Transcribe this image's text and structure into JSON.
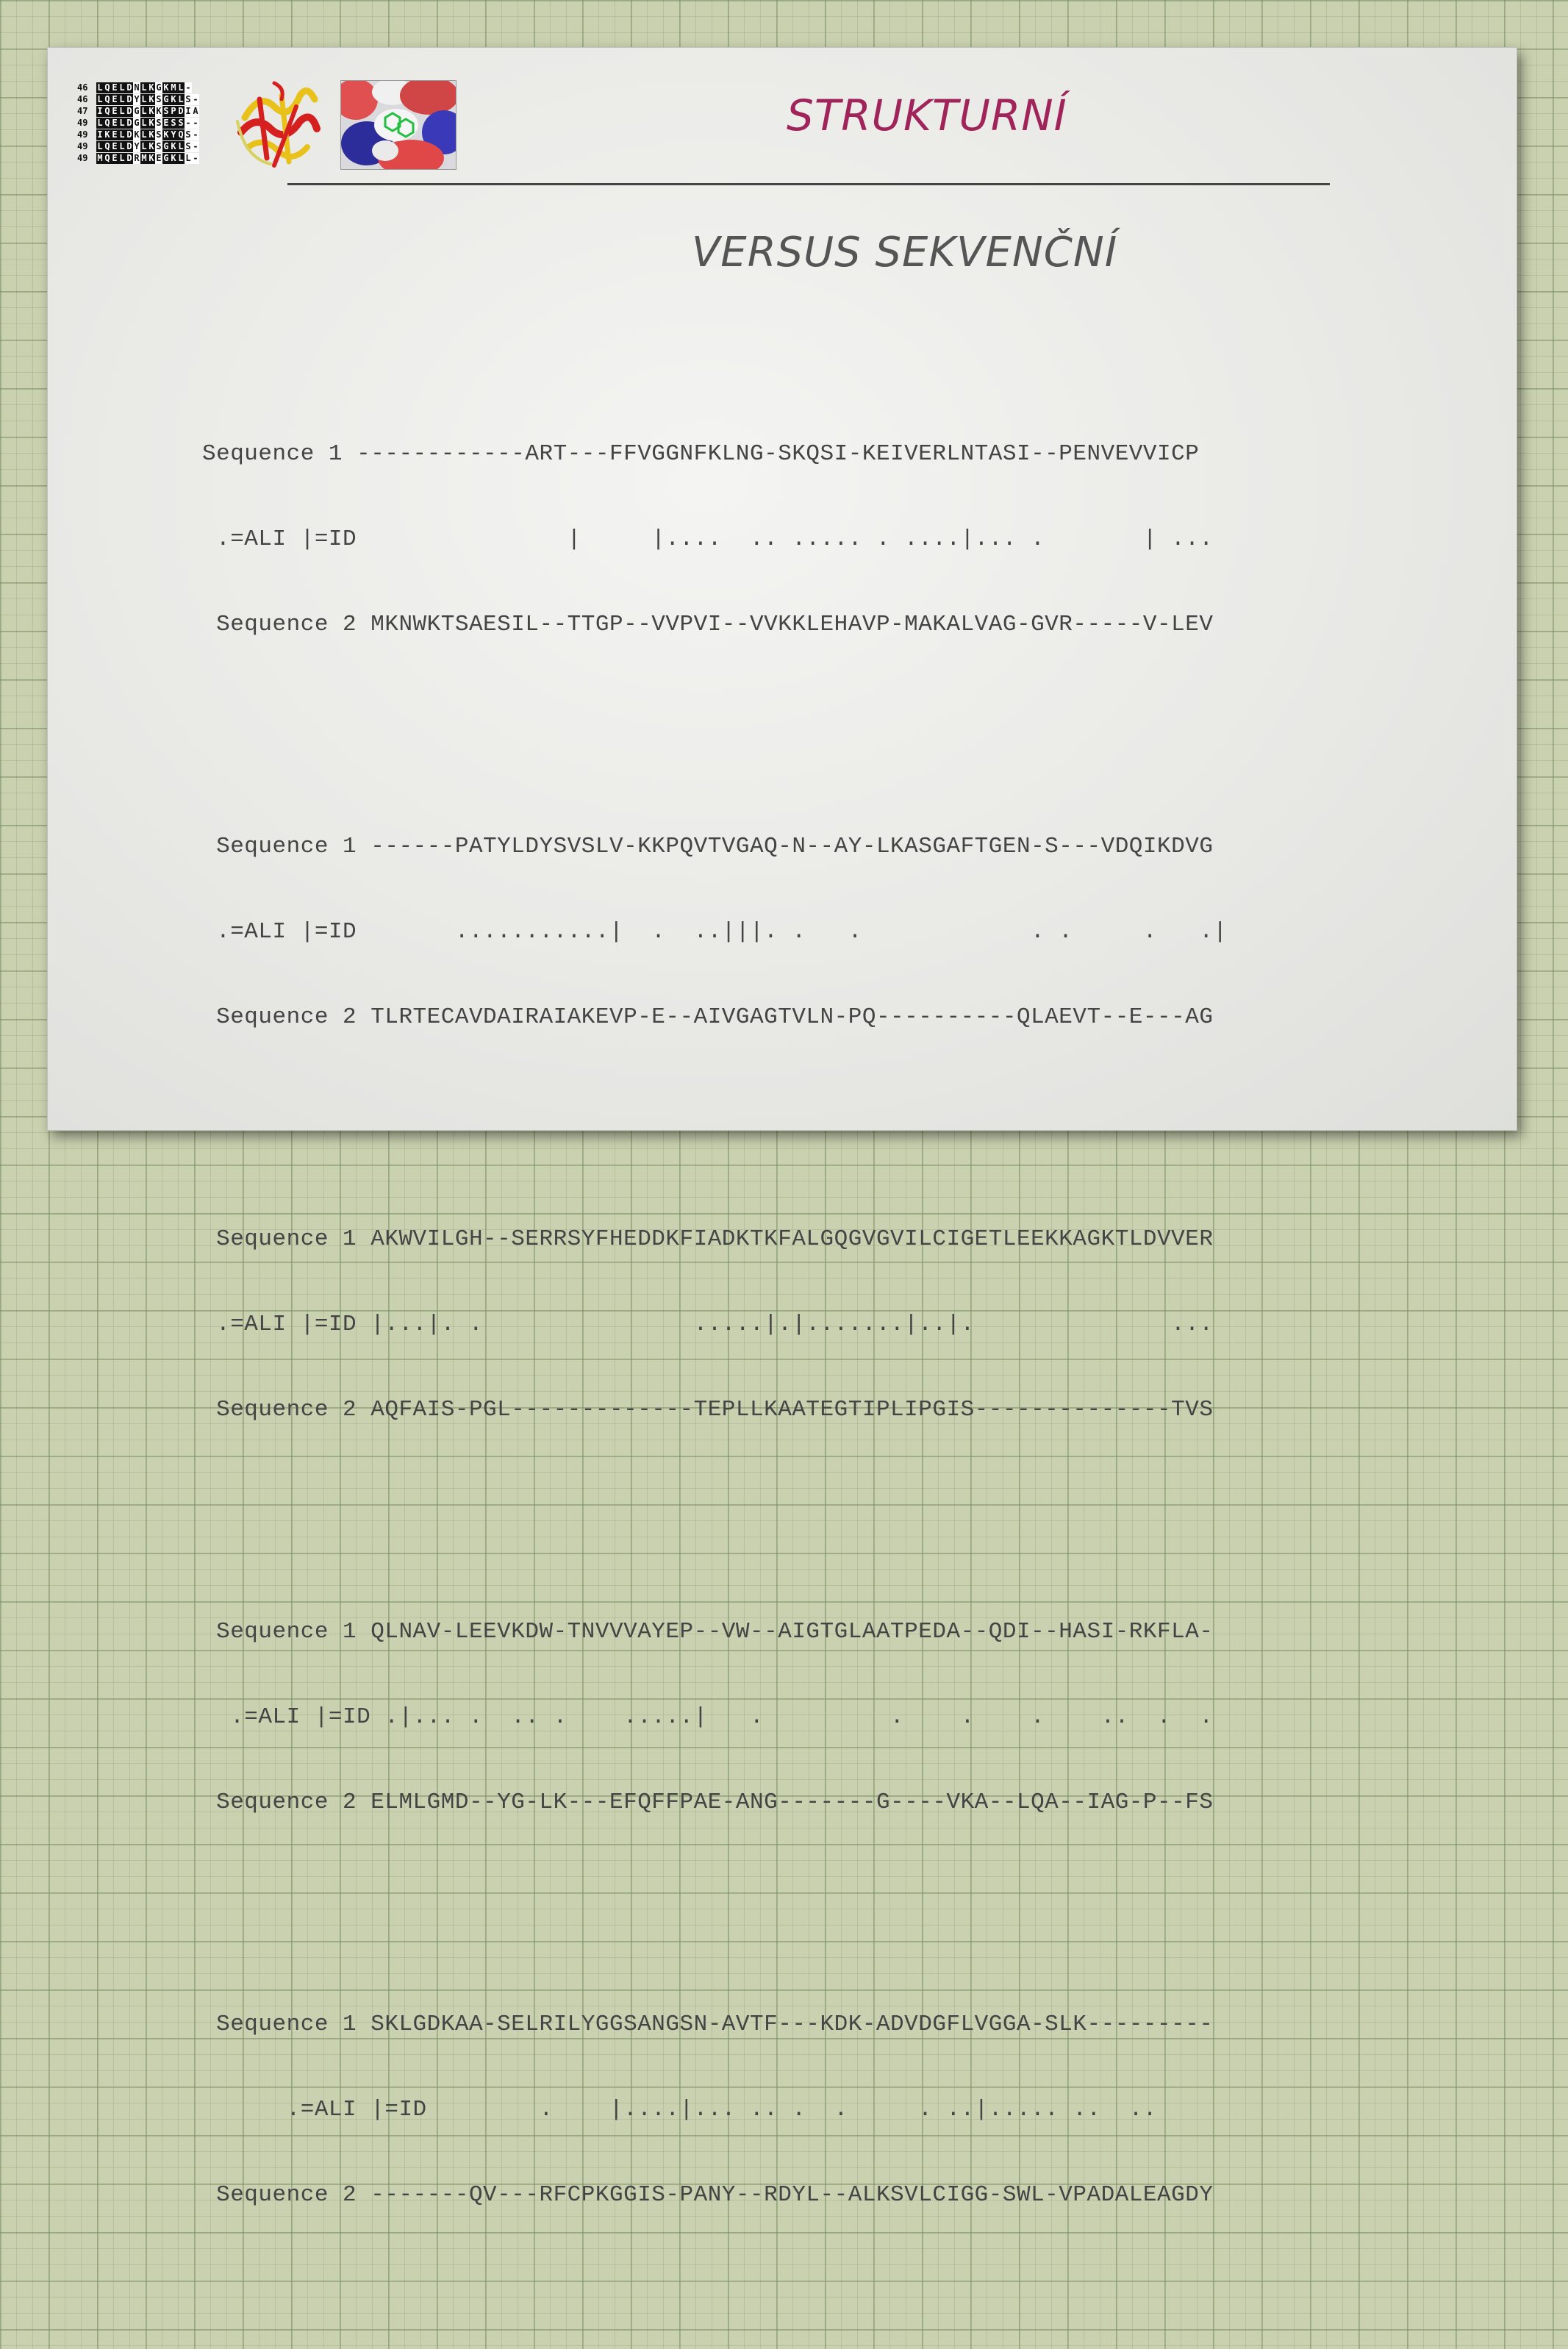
{
  "title": "STRUKTURNÍ",
  "subtitle": "VERSUS SEKVENČNÍ",
  "msa_snippet": [
    {
      "num": "46",
      "seq": "LQELDNLKGKML-"
    },
    {
      "num": "46",
      "seq": "LQELDYLKSGKLS-"
    },
    {
      "num": "47",
      "seq": "IQELDGLKKSPDIA"
    },
    {
      "num": "49",
      "seq": "LQELDGLKSESS--"
    },
    {
      "num": "49",
      "seq": "IKELDKLKSKYQS-"
    },
    {
      "num": "49",
      "seq": "LQELDYLKSGKLS-"
    },
    {
      "num": "49",
      "seq": "MQELDRMKEGKLL-"
    }
  ],
  "alignment": [
    {
      "seq1": "Sequence 1 ------------ART---FFVGGNFKLNG-SKQSI-KEIVERLNTASI--PENVEVVICP",
      "mid": " .=ALI |=ID               |     |....  .. ..... . ....|... .       | ...",
      "seq2": " Sequence 2 MKNWKTSAESIL--TTGP--VVPVI--VVKKLEHAVP-MAKALVAG-GVR-----V-LEV"
    },
    {
      "seq1": " Sequence 1 ------PATYLDYSVSLV-KKPQVTVGAQ-N--AY-LKASGAFTGEN-S---VDQIKDVG",
      "mid": " .=ALI |=ID       ...........|  .  ..|||. .   .            . .     .   .|",
      "seq2": " Sequence 2 TLRTECAVDAIRAIAKEVP-E--AIVGAGTVLN-PQ----------QLAEVT--E---AG"
    },
    {
      "seq1": " Sequence 1 AKWVILGH--SERRSYFHEDDKFIADKTKFALGQGVGVILCIGETLEEKKAGKTLDVVER",
      "mid": " .=ALI |=ID |...|. .               .....|.|.......|..|.              ...",
      "seq2": " Sequence 2 AQFAIS-PGL-------------TEPLLKAATEGTIPLIPGIS--------------TVS"
    },
    {
      "seq1": " Sequence 1 QLNAV-LEEVKDW-TNVVVAYEP--VW--AIGTGLAATPEDA--QDI--HASI-RKFLA-",
      "mid": "  .=ALI |=ID .|... .  .. .    .....|   .         .    .    .    ..  .  .",
      "seq2": " Sequence 2 ELMLGMD--YG-LK---EFQFFPAE-ANG-------G----VKA--LQA--IAG-P--FS"
    },
    {
      "seq1": " Sequence 1 SKLGDKAA-SELRILYGGSANGSN-AVTF---KDK-ADVDGFLVGGA-SLK---------",
      "mid": "      .=ALI |=ID        .    |....|... .. .  .     . ..|..... ..  ..",
      "seq2": " Sequence 2 -------QV---RFCPKGGIS-PANY--RDYL--ALKSVLCIGG-SWL-VPADALEAGDY"
    }
  ]
}
